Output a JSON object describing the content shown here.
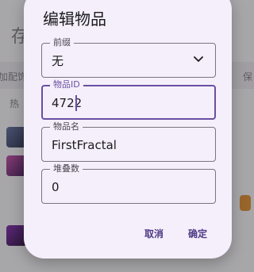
{
  "background": {
    "title": "存",
    "tab_left": "加配饰",
    "tab_right": "保",
    "section": "热"
  },
  "dialog": {
    "title": "编辑物品",
    "fields": {
      "prefix": {
        "label": "前缀",
        "value": "无"
      },
      "item_id": {
        "label": "物品ID",
        "value": "4722"
      },
      "item_name": {
        "label": "物品名",
        "value": "FirstFractal"
      },
      "stack_count": {
        "label": "堆叠数",
        "value": "0"
      }
    },
    "actions": {
      "cancel": "取消",
      "confirm": "确定"
    }
  },
  "icons": {
    "dropdown": "chevron-down-icon"
  },
  "colors": {
    "accent": "#6a4fa3",
    "dialog_bg": "#f4effa"
  }
}
